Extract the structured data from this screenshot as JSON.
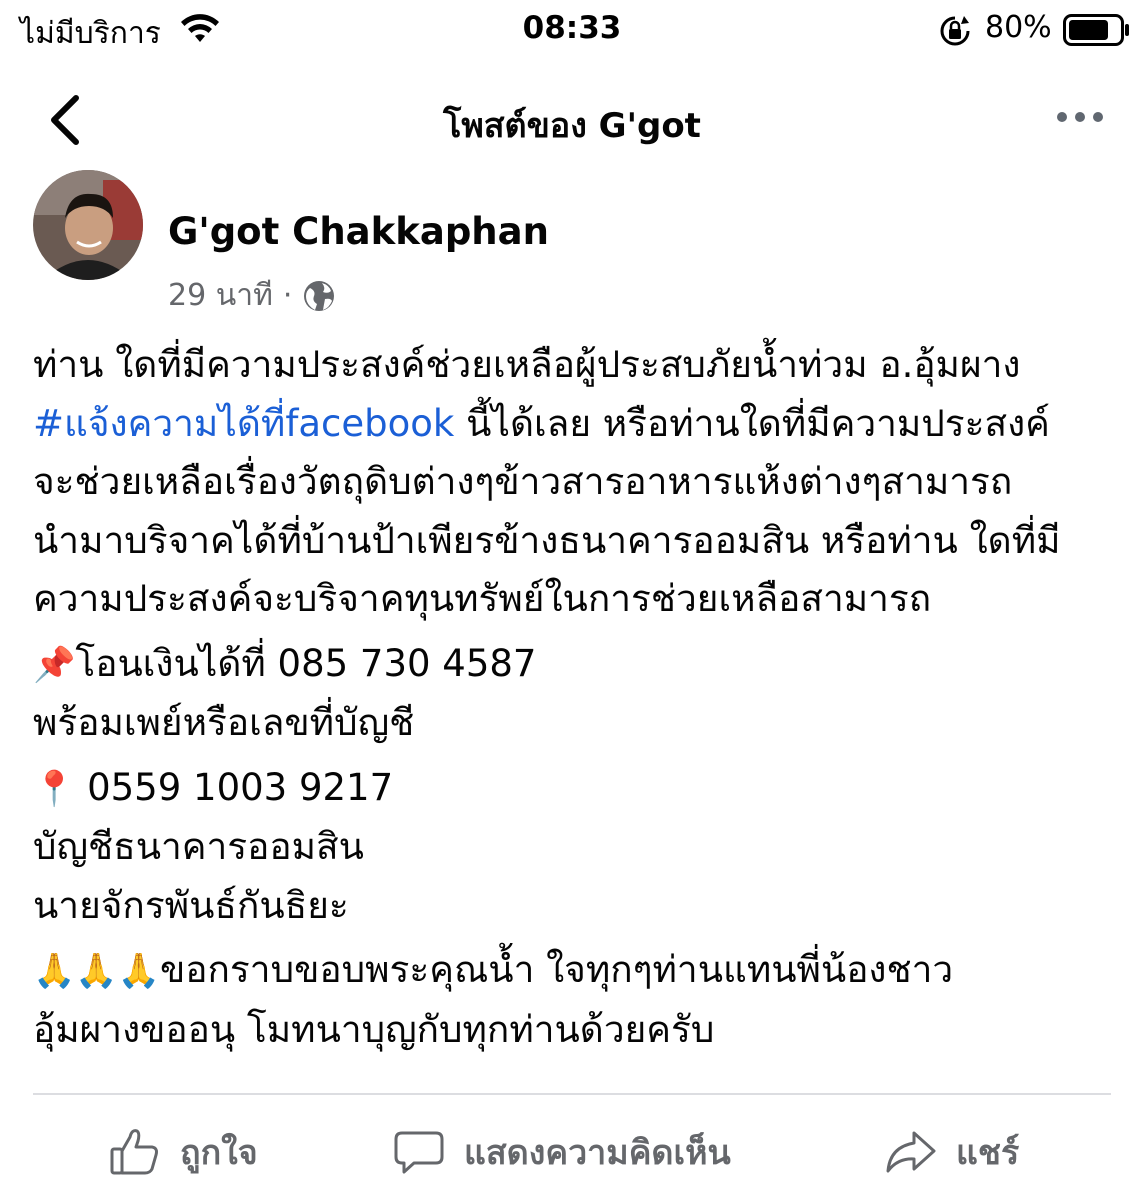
{
  "status_bar": {
    "carrier": "ไม่มีบริการ",
    "time": "08:33",
    "battery_percent": "80%",
    "battery_level": 0.8,
    "icons": [
      "wifi-icon",
      "orientation-lock-icon",
      "battery-icon"
    ]
  },
  "header": {
    "title": "โพสต์ของ G'got",
    "icons": [
      "back-chevron-icon",
      "more-icon"
    ]
  },
  "post": {
    "author": "G'got Chakkaphan",
    "time_ago": "29 นาที",
    "separator": "·",
    "privacy_icon": "globe-icon",
    "line1": "ท่าน ใดที่มีความประสงค์ช่วยเหลือผู้ประสบภัยน้ำท่วม อ.อุ้มผาง",
    "hashtag": "#แจ้งความได้ที่facebook",
    "line2_rest": " นี้ได้เลย หรือท่านใดที่มีความประสงค์",
    "line3": "จะช่วยเหลือเรื่องวัตถุดิบต่างๆข้าวสารอาหารแห้งต่างๆสามารถ",
    "line4": "นำมาบริจาคได้ที่บ้านป้าเพียรข้างธนาคารออมสิน หรือท่าน ใดที่มี",
    "line5": "ความประสงค์จะบริจาคทุนทรัพย์ในการช่วยเหลือสามารถ",
    "pin_emoji": "📌",
    "transfer_line": "โอนเงินได้ที่ 085 730 4587",
    "promptpay_line": "พร้อมเพย์หรือเลขที่บัญชี",
    "round_pin_emoji": "📍",
    "account_number": " 0559 1003 9217",
    "bank_line": "บัญชีธนาคารออมสิน",
    "name_line": "นายจักรพันธ์กันธิยะ",
    "pray_emojis": "🙏🙏🙏",
    "thanks_line": "ขอกราบขอบพระคุณน้ำ ใจทุกๆท่านแทนพี่น้องชาว",
    "closing_line": "อุ้มผางขออนุ โมทนาบุญกับทุกท่านด้วยครับ"
  },
  "actions": {
    "like_label": "ถูกใจ",
    "comment_label": "แสดงความคิดเห็น",
    "share_label": "แชร์",
    "icons": [
      "like-icon",
      "comment-icon",
      "share-icon"
    ]
  },
  "colors": {
    "hashtag": "#1b5fd6",
    "secondary_text": "#65676b",
    "primary_text": "#050505"
  }
}
